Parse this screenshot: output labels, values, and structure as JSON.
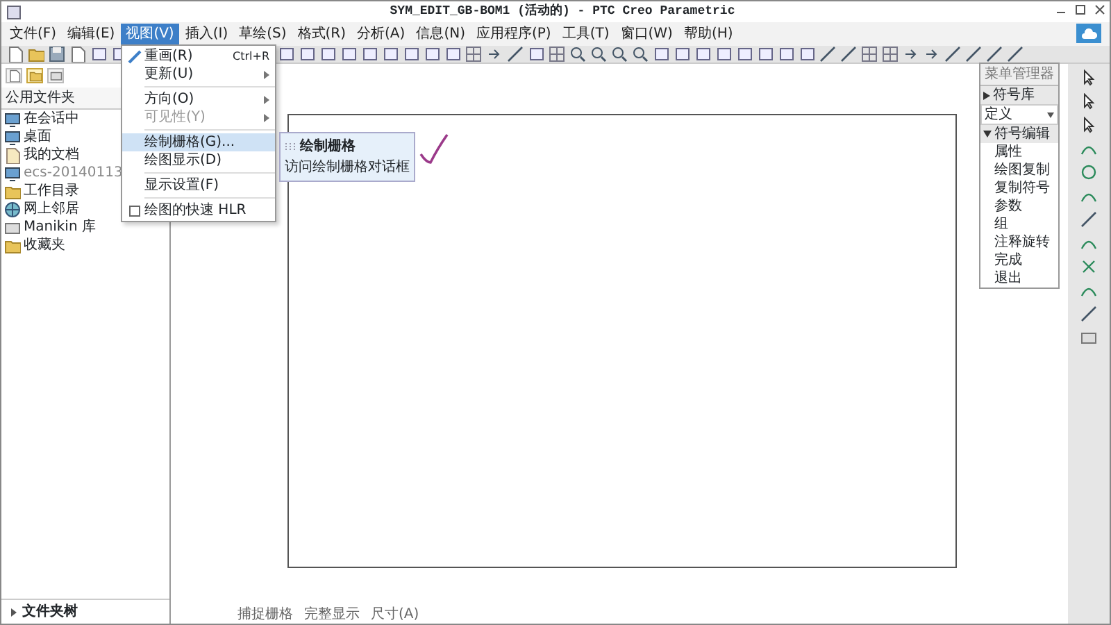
{
  "window": {
    "title": "SYM_EDIT_GB-BOM1 (活动的) - PTC Creo Parametric"
  },
  "menu_bar": [
    {
      "label": "文件(F)",
      "selected": false
    },
    {
      "label": "编辑(E)",
      "selected": false
    },
    {
      "label": "视图(V)",
      "selected": true
    },
    {
      "label": "插入(I)",
      "selected": false
    },
    {
      "label": "草绘(S)",
      "selected": false
    },
    {
      "label": "格式(R)",
      "selected": false
    },
    {
      "label": "分析(A)",
      "selected": false
    },
    {
      "label": "信息(N)",
      "selected": false
    },
    {
      "label": "应用程序(P)",
      "selected": false
    },
    {
      "label": "工具(T)",
      "selected": false
    },
    {
      "label": "窗口(W)",
      "selected": false
    },
    {
      "label": "帮助(H)",
      "selected": false
    }
  ],
  "view_menu": [
    {
      "kind": "command",
      "label": "重画(R)",
      "shortcut": "Ctrl+R",
      "disabled": false,
      "selected": false
    },
    {
      "kind": "submenu",
      "label": "更新(U)",
      "disabled": false,
      "selected": false
    },
    {
      "kind": "separator"
    },
    {
      "kind": "submenu",
      "label": "方向(O)",
      "disabled": false,
      "selected": false
    },
    {
      "kind": "submenu",
      "label": "可见性(Y)",
      "disabled": true,
      "selected": false
    },
    {
      "kind": "separator"
    },
    {
      "kind": "command",
      "label": "绘制栅格(G)...",
      "disabled": false,
      "selected": true
    },
    {
      "kind": "command",
      "label": "绘图显示(D)",
      "disabled": false,
      "selected": false
    },
    {
      "kind": "separator"
    },
    {
      "kind": "command",
      "label": "显示设置(F)",
      "disabled": false,
      "selected": false
    },
    {
      "kind": "separator"
    },
    {
      "kind": "check",
      "label": "绘图的快速 HLR",
      "checked": false,
      "disabled": false,
      "selected": false
    }
  ],
  "tooltip": {
    "title": "绘制栅格",
    "description": "访问绘制栅格对话框"
  },
  "navigator": {
    "tabs": [
      {
        "selected": false
      },
      {
        "selected": true
      },
      {
        "selected": false
      }
    ],
    "section_title": "公用文件夹",
    "folders": [
      {
        "label": "在会话中",
        "disabled": false
      },
      {
        "label": "桌面",
        "disabled": false
      },
      {
        "label": "我的文档",
        "disabled": false
      },
      {
        "label": "ecs-20140113",
        "disabled": true
      },
      {
        "label": "工作目录",
        "disabled": false
      },
      {
        "label": "网上邻居",
        "disabled": false
      },
      {
        "label": "Manikin 库",
        "disabled": false
      },
      {
        "label": "收藏夹",
        "disabled": false
      }
    ],
    "footer": "文件夹树"
  },
  "menu_manager": {
    "title": "菜单管理器",
    "items": [
      {
        "kind": "collapsed",
        "label": "符号库"
      },
      {
        "kind": "dropdown",
        "label": "定义"
      },
      {
        "kind": "expanded",
        "label": "符号编辑"
      },
      {
        "kind": "item",
        "label": "属性"
      },
      {
        "kind": "item",
        "label": "绘图复制"
      },
      {
        "kind": "item",
        "label": "复制符号"
      },
      {
        "kind": "item",
        "label": "参数"
      },
      {
        "kind": "item",
        "label": "组"
      },
      {
        "kind": "item",
        "label": "注释旋转"
      },
      {
        "kind": "item",
        "label": "完成"
      },
      {
        "kind": "item",
        "label": "退出"
      }
    ]
  },
  "status_bar": [
    "捕捉栅格",
    "完整显示",
    "尺寸(A)"
  ]
}
